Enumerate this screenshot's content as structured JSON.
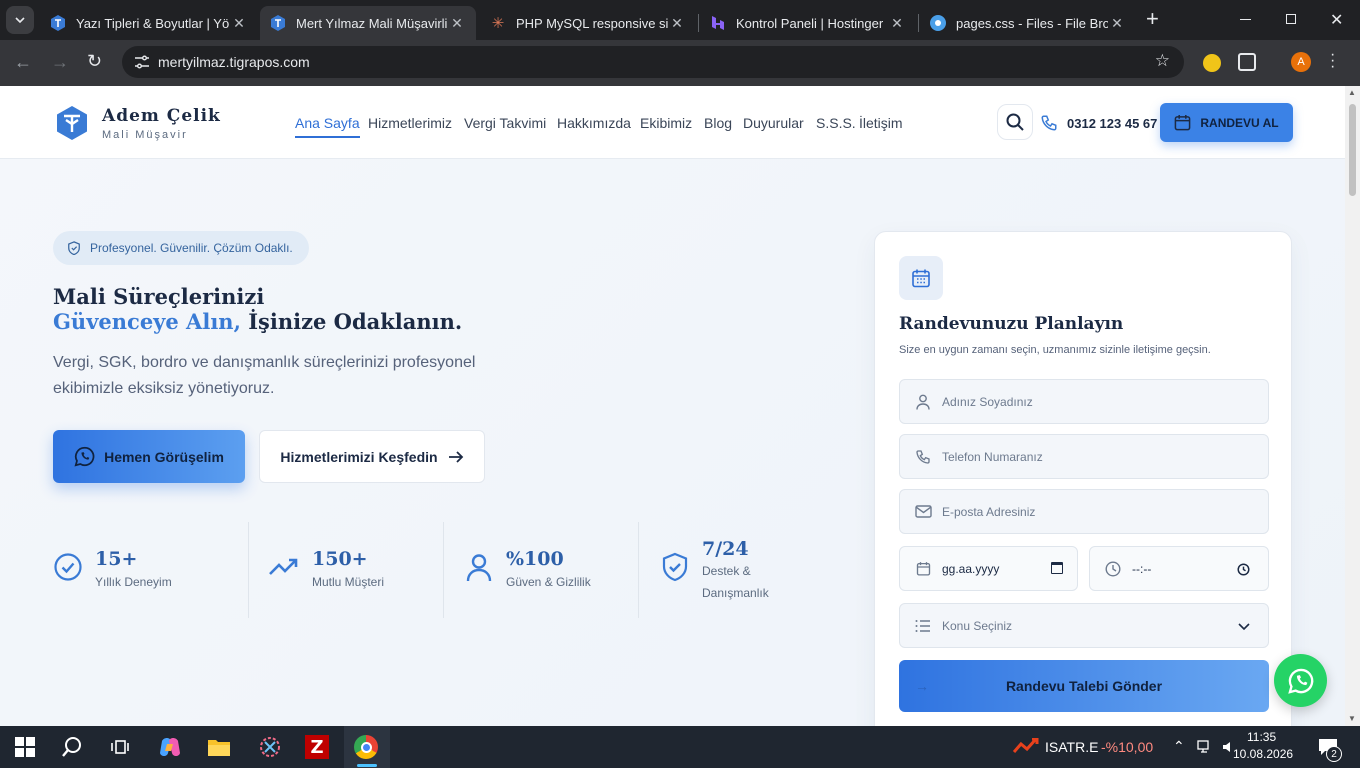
{
  "browser": {
    "tabs": [
      {
        "title": "Yazı Tipleri & Boyutlar | Yöne",
        "favicon": "brand-logo-icon",
        "color": "#3a7bd5"
      },
      {
        "title": "Mert Yılmaz Mali Müşavirlik",
        "favicon": "brand-logo-icon",
        "color": "#3a7bd5"
      },
      {
        "title": "PHP MySQL responsive site",
        "favicon": "claude-spark-icon",
        "color": "#d97757"
      },
      {
        "title": "Kontrol Paneli | Hostinger",
        "favicon": "hostinger-icon",
        "color": "#673de6"
      },
      {
        "title": "pages.css - Files - File Brows",
        "favicon": "file-browser-icon",
        "color": "#4a9fe8"
      }
    ],
    "url": "mertyilmaz.tigrapos.com",
    "profile_initial": "A"
  },
  "header": {
    "brand_name": "Adem Çelik",
    "brand_sub": "Mali Müşavir",
    "nav": [
      "Ana Sayfa",
      "Hizmetlerimiz",
      "Vergi Takvimi",
      "Hakkımızda",
      "Ekibimiz",
      "Blog",
      "Duyurular",
      "S.S.S.",
      "İletişim"
    ],
    "phone": "0312 123 45 67",
    "cta": "RANDEVU AL"
  },
  "hero": {
    "badge": "Profesyonel. Güvenilir. Çözüm Odaklı.",
    "title_line1": "Mali Süreçlerinizi",
    "title_blue": "Güvenceye Alın,",
    "title_rest": " İşinize Odaklanın.",
    "lead": "Vergi, SGK, bordro ve danışmanlık süreçlerinizi profesyonel ekibimizle eksiksiz yönetiyoruz.",
    "primary_button": "Hemen Görüşelim",
    "secondary_button": "Hizmetlerimizi Keşfedin"
  },
  "stats": [
    {
      "value": "15+",
      "label": "Yıllık Deneyim",
      "icon": "check-badge-icon"
    },
    {
      "value": "150+",
      "label": "Mutlu Müşteri",
      "icon": "trending-up-icon"
    },
    {
      "value": "%100",
      "label": "Güven & Gizlilik",
      "icon": "user-icon"
    },
    {
      "value": "7/24",
      "label": "Destek & Danışmanlık",
      "icon": "shield-check-icon"
    }
  ],
  "form": {
    "title": "Randevunuzu Planlayın",
    "subtitle": "Size en uygun zamanı seçin, uzmanımız sizinle iletişime geçsin.",
    "name_placeholder": "Adınız Soyadınız",
    "phone_placeholder": "Telefon Numaranız",
    "email_placeholder": "E-posta Adresiniz",
    "date_placeholder": "gg.aa.yyyy",
    "time_placeholder": "--:--",
    "topic_placeholder": "Konu Seçiniz",
    "submit": "Randevu Talebi Gönder"
  },
  "taskbar": {
    "ticker_name": "ISATR.E",
    "ticker_change": "-%10,00",
    "time": "11:35",
    "date": "10.08.2026",
    "notifications": "2"
  },
  "colors": {
    "accent": "#3a7bd5",
    "navy": "#1c2a44",
    "whatsapp": "#25d366"
  }
}
